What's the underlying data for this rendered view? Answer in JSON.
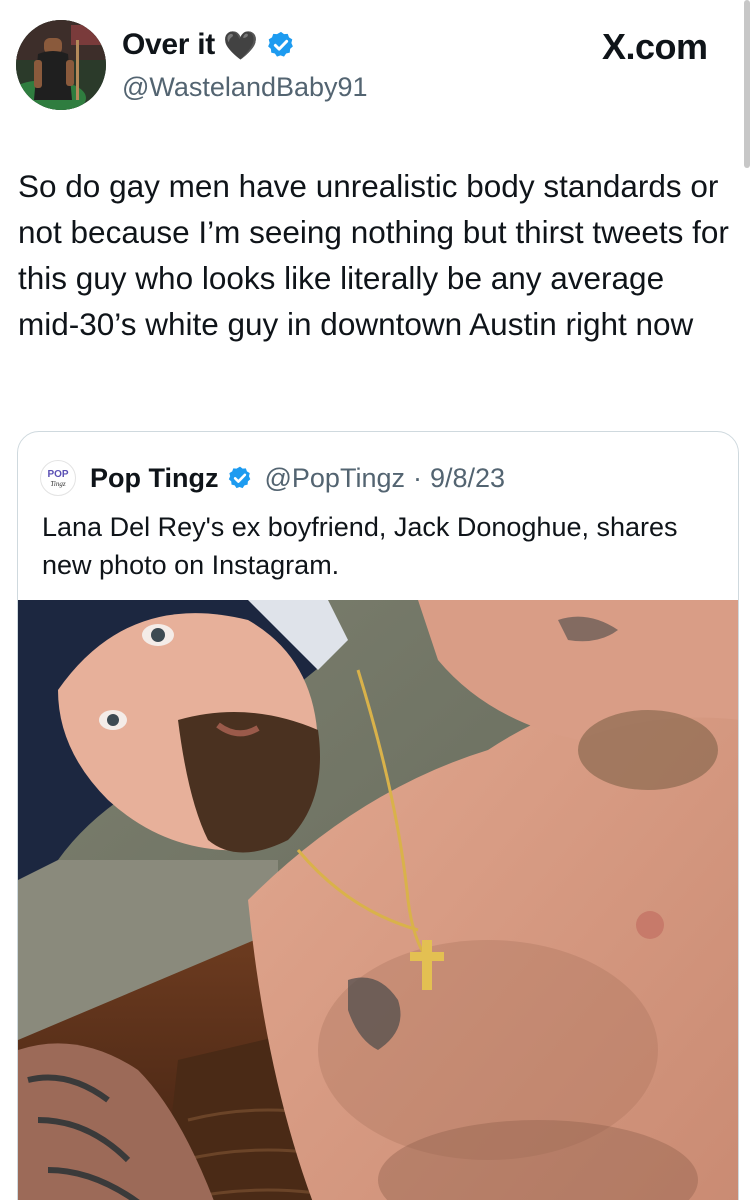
{
  "header": {
    "display_name": "Over it",
    "heart_emoji": "🖤",
    "handle": "@WastelandBaby91",
    "site_brand": "X.com",
    "verified_icon": "verified-badge-icon"
  },
  "tweet": {
    "text": "So do gay men have unrealistic body standards or not because I’m seeing nothing but thirst tweets for this guy who looks like literally be any average mid-30’s white guy in downtown Austin right now"
  },
  "quoted_tweet": {
    "avatar_text": "POP Tingz",
    "display_name": "Pop Tingz",
    "handle": "@PopTingz",
    "separator": "·",
    "date": "9/8/23",
    "text": "Lana Del Rey's ex boyfriend, Jack Donoghue, shares new photo on Instagram."
  },
  "colors": {
    "text_primary": "#0f1419",
    "text_secondary": "#536471",
    "verified_blue": "#1d9bf0",
    "card_border": "#cfd9de"
  }
}
